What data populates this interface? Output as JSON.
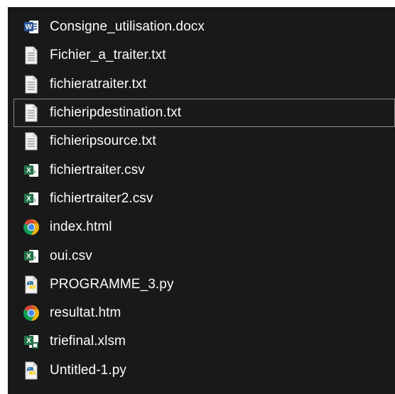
{
  "files": [
    {
      "name": "Consigne_utilisation.docx",
      "icon": "word-document-icon",
      "selected": false
    },
    {
      "name": "Fichier_a_traiter.txt",
      "icon": "text-file-icon",
      "selected": false
    },
    {
      "name": "fichieratraiter.txt",
      "icon": "text-file-icon",
      "selected": false
    },
    {
      "name": "fichieripdestination.txt",
      "icon": "text-file-icon",
      "selected": true
    },
    {
      "name": "fichieripsource.txt",
      "icon": "text-file-icon",
      "selected": false
    },
    {
      "name": "fichiertraiter.csv",
      "icon": "excel-csv-icon",
      "selected": false
    },
    {
      "name": "fichiertraiter2.csv",
      "icon": "excel-csv-icon",
      "selected": false
    },
    {
      "name": "index.html",
      "icon": "chrome-icon",
      "selected": false
    },
    {
      "name": "oui.csv",
      "icon": "excel-csv-icon",
      "selected": false
    },
    {
      "name": "PROGRAMME_3.py",
      "icon": "python-file-icon",
      "selected": false
    },
    {
      "name": "resultat.htm",
      "icon": "chrome-icon",
      "selected": false
    },
    {
      "name": "triefinal.xlsm",
      "icon": "excel-macro-icon",
      "selected": false
    },
    {
      "name": "Untitled-1.py",
      "icon": "python-file-icon",
      "selected": false
    }
  ],
  "colors": {
    "background": "#191919",
    "text": "#ffffff",
    "selection_border": "#8c8c8c",
    "word_blue": "#2b579a",
    "excel_green": "#217346",
    "chrome_red": "#db4437",
    "chrome_yellow": "#f4b400",
    "chrome_green": "#0f9d58",
    "chrome_blue": "#4285f4",
    "python_blue": "#3776ab",
    "python_yellow": "#ffd43b"
  }
}
